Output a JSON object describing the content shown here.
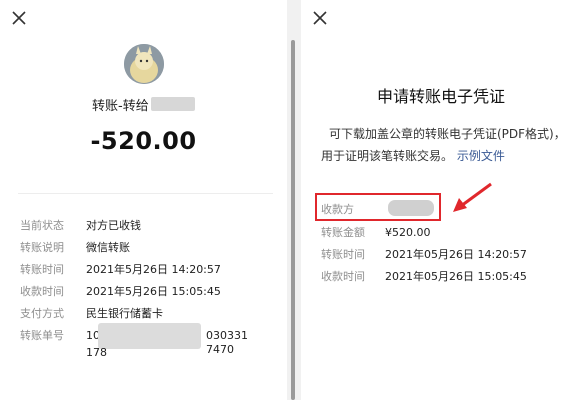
{
  "left": {
    "payee_prefix": "转账-转给",
    "amount": "-520.00",
    "details": [
      {
        "label": "当前状态",
        "value": "对方已收钱"
      },
      {
        "label": "转账说明",
        "value": "微信转账"
      },
      {
        "label": "转账时间",
        "value": "2021年5月26日 14:20:57"
      },
      {
        "label": "收款时间",
        "value": "2021年5月26日 15:05:45"
      },
      {
        "label": "支付方式",
        "value": "民生银行储蓄卡"
      },
      {
        "label": "转账单号",
        "value_head": "10",
        "value_tail": "0303317470",
        "value_line2": "178"
      }
    ]
  },
  "right": {
    "title": "申请转账电子凭证",
    "description": "可下载加盖公章的转账电子凭证(PDF格式)，用于证明该笔转账交易。",
    "link": "示例文件",
    "details": [
      {
        "label": "收款方",
        "value": ""
      },
      {
        "label": "转账金额",
        "value": "¥520.00"
      },
      {
        "label": "转账时间",
        "value": "2021年05月26日 14:20:57"
      },
      {
        "label": "收款时间",
        "value": "2021年05月26日 15:05:45"
      }
    ]
  },
  "colors": {
    "highlight": "#e0272c",
    "link": "#3b5b95"
  }
}
